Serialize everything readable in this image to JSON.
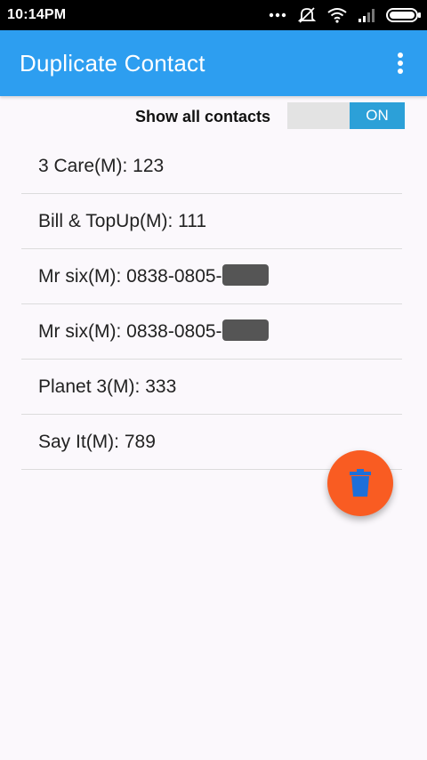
{
  "status_bar": {
    "time": "10:14PM",
    "icons": [
      "signal-dots-icon",
      "mute-icon",
      "wifi-icon",
      "cell-signal-icon",
      "battery-icon"
    ]
  },
  "app_bar": {
    "title": "Duplicate Contact",
    "menu_icon": "overflow-menu-icon",
    "color": "#2d9ef0"
  },
  "toggle": {
    "label": "Show all contacts",
    "state": "ON",
    "color": "#2ca0d8"
  },
  "contacts": [
    {
      "text": "3 Care(M): 123",
      "redacted": false
    },
    {
      "text": "Bill & TopUp(M): 111",
      "redacted": false
    },
    {
      "text": "Mr six(M): 0838-0805-",
      "redacted": true
    },
    {
      "text": "Mr six(M): 0838-0805-",
      "redacted": true
    },
    {
      "text": "Planet 3(M): 333",
      "redacted": false
    },
    {
      "text": "Say It(M): 789",
      "redacted": false
    }
  ],
  "fab": {
    "icon": "trash-icon",
    "color": "#f95c22"
  }
}
